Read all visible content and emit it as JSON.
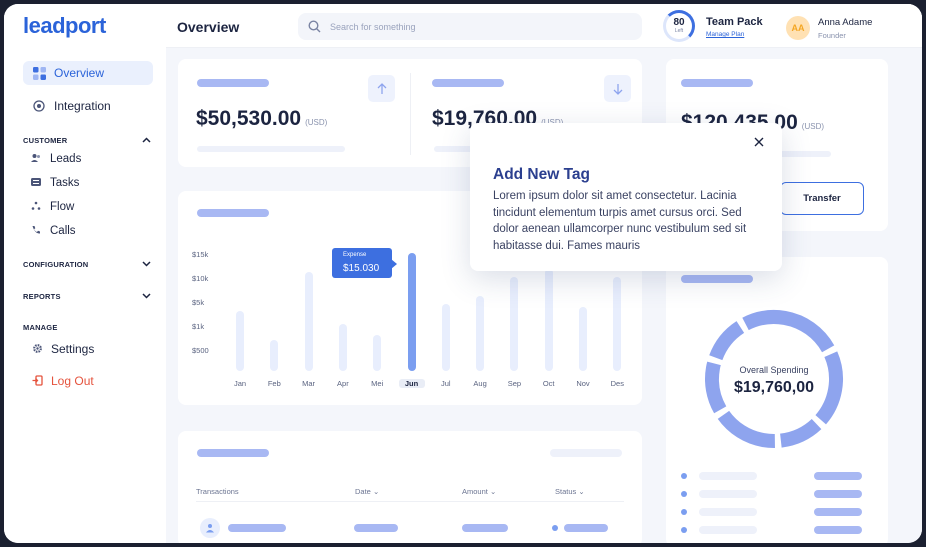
{
  "app": {
    "logo": "leadport"
  },
  "sidebar": {
    "items": [
      {
        "label": "Overview",
        "icon": "grid-icon"
      },
      {
        "label": "Integration",
        "icon": "plug-icon"
      }
    ],
    "sections": [
      {
        "label": "CUSTOMER",
        "expanded": true,
        "items": [
          {
            "label": "Leads",
            "icon": "users-icon"
          },
          {
            "label": "Tasks",
            "icon": "list-icon"
          },
          {
            "label": "Flow",
            "icon": "flow-icon"
          },
          {
            "label": "Calls",
            "icon": "phone-icon"
          }
        ]
      },
      {
        "label": "CONFIGURATION",
        "expanded": false
      },
      {
        "label": "REPORTS",
        "expanded": false
      },
      {
        "label": "MANAGE",
        "expanded": true,
        "items": [
          {
            "label": "Settings",
            "icon": "gear-icon"
          }
        ]
      }
    ],
    "logout": "Log Out"
  },
  "header": {
    "title": "Overview",
    "search_placeholder": "Search for something",
    "plan": {
      "count": "80",
      "count_label": "Left",
      "name": "Team Pack",
      "link": "Manage Plan"
    },
    "user": {
      "initials": "AA",
      "name": "Anna Adame",
      "role": "Founder"
    }
  },
  "stats": [
    {
      "amount": "$50,530.00",
      "unit": "(USD)"
    },
    {
      "amount": "$19,760.00",
      "unit": "(USD)"
    },
    {
      "amount": "$120,435.00",
      "unit": "(USD)"
    }
  ],
  "transfer_label": "Transfer",
  "chart_data": {
    "type": "bar",
    "categories": [
      "Jan",
      "Feb",
      "Mar",
      "Apr",
      "Mei",
      "Jun",
      "Jul",
      "Aug",
      "Sep",
      "Oct",
      "Nov",
      "Des"
    ],
    "y_ticks": [
      "$15k",
      "$10k",
      "$5k",
      "$1k",
      "$500"
    ],
    "values": [
      7.6,
      4.0,
      12.6,
      6.0,
      4.6,
      15.03,
      8.5,
      9.5,
      12.0,
      13.0,
      8.2,
      12.0
    ],
    "selected": "Jun",
    "tooltip": {
      "label": "Expense",
      "value": "$15.030"
    }
  },
  "transactions": {
    "columns": [
      "Transactions",
      "Date",
      "Amount",
      "Status"
    ]
  },
  "spending": {
    "label": "Overall Spending",
    "value": "$19,760,00"
  },
  "modal": {
    "title": "Add New Tag",
    "body": "Lorem ipsum dolor sit amet consectetur. Lacinia tincidunt elementum turpis amet cursus orci. Sed dolor aenean ullamcorper nunc vestibulum sed sit habitasse dui. Fames mauris"
  },
  "colors": {
    "accent": "#3d6fe0",
    "logout": "#e5533d",
    "placeholder": "#a8b8f3"
  }
}
